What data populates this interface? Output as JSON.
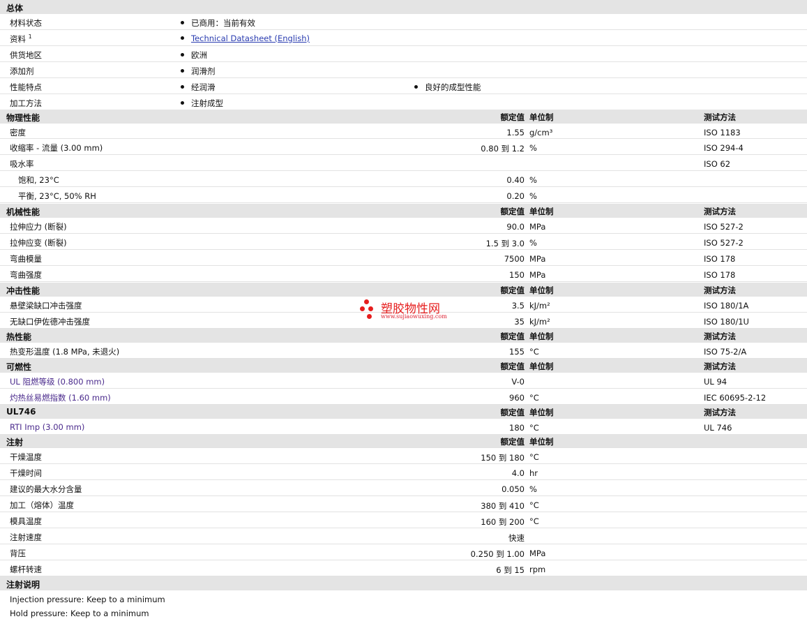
{
  "cols": {
    "val": "额定值",
    "unit": "单位制",
    "test": "测试方法"
  },
  "general": {
    "title": "总体",
    "status_label": "材料状态",
    "status_value": "已商用：当前有效",
    "doc_label": "资料",
    "doc_sup": "1",
    "doc_link": "Technical Datasheet (English)",
    "region_label": "供货地区",
    "region_value": "欧洲",
    "additive_label": "添加剂",
    "additive_value": "润滑剂",
    "feature_label": "性能特点",
    "feature_value1": "经润滑",
    "feature_value2": "良好的成型性能",
    "process_label": "加工方法",
    "process_value": "注射成型"
  },
  "physical": {
    "title": "物理性能",
    "rows": [
      {
        "label": "密度",
        "val": "1.55",
        "unit": "g/cm³",
        "test": "ISO 1183"
      },
      {
        "label": "收缩率  - 流量  (3.00 mm)",
        "val": "0.80 到  1.2",
        "unit": "%",
        "test": "ISO 294-4"
      },
      {
        "label": "吸水率",
        "val": "",
        "unit": "",
        "test": "ISO 62"
      },
      {
        "label": "饱和, 23°C",
        "val": "0.40",
        "unit": "%",
        "test": ""
      },
      {
        "label": "平衡, 23°C, 50% RH",
        "val": "0.20",
        "unit": "%",
        "test": ""
      }
    ]
  },
  "mechanical": {
    "title": "机械性能",
    "rows": [
      {
        "label": "拉伸应力  (断裂)",
        "val": "90.0",
        "unit": "MPa",
        "test": "ISO 527-2"
      },
      {
        "label": "拉伸应变  (断裂)",
        "val": "1.5 到  3.0",
        "unit": "%",
        "test": "ISO 527-2"
      },
      {
        "label": "弯曲模量",
        "val": "7500",
        "unit": "MPa",
        "test": "ISO 178"
      },
      {
        "label": "弯曲强度",
        "val": "150",
        "unit": "MPa",
        "test": "ISO 178"
      }
    ]
  },
  "impact": {
    "title": "冲击性能",
    "rows": [
      {
        "label": "悬壁梁缺口冲击强度",
        "val": "3.5",
        "unit": "kJ/m²",
        "test": "ISO 180/1A"
      },
      {
        "label": "无缺口伊佐德冲击强度",
        "val": "35",
        "unit": "kJ/m²",
        "test": "ISO 180/1U"
      }
    ]
  },
  "thermal": {
    "title": "热性能",
    "rows": [
      {
        "label": "热变形温度  (1.8 MPa, 未退火)",
        "val": "155",
        "unit": "°C",
        "test": "ISO 75-2/A"
      }
    ]
  },
  "flammability": {
    "title": "可燃性",
    "rows": [
      {
        "label": "UL 阻燃等级  (0.800 mm)",
        "val": "V-0",
        "unit": "",
        "test": "UL 94"
      },
      {
        "label": "灼热丝易燃指数  (1.60 mm)",
        "val": "960",
        "unit": "°C",
        "test": "IEC 60695-2-12"
      }
    ]
  },
  "ul746": {
    "title": "UL746",
    "rows": [
      {
        "label": "RTI Imp (3.00 mm)",
        "val": "180",
        "unit": "°C",
        "test": "UL 746"
      }
    ]
  },
  "injection": {
    "title": "注射",
    "rows": [
      {
        "label": "干燥温度",
        "val": "150 到  180",
        "unit": "°C"
      },
      {
        "label": "干燥时间",
        "val": "4.0",
        "unit": "hr"
      },
      {
        "label": "建议的最大水分含量",
        "val": "0.050",
        "unit": "%"
      },
      {
        "label": "加工（熔体）温度",
        "val": "380 到  410",
        "unit": "°C"
      },
      {
        "label": "模具温度",
        "val": "160 到  200",
        "unit": "°C"
      },
      {
        "label": "注射速度",
        "val": "快速",
        "unit": ""
      },
      {
        "label": "背压",
        "val": "0.250 到  1.00",
        "unit": "MPa"
      },
      {
        "label": "螺杆转速",
        "val": "6 到  15",
        "unit": "rpm"
      }
    ]
  },
  "notes": {
    "title": "注射说明",
    "line1": "Injection pressure: Keep to a minimum",
    "line2": "Hold pressure: Keep to a minimum"
  },
  "watermark": {
    "cn": "塑胶物性网",
    "url": "www.sujiaowuxing.com",
    "color": "#e61e1e"
  }
}
